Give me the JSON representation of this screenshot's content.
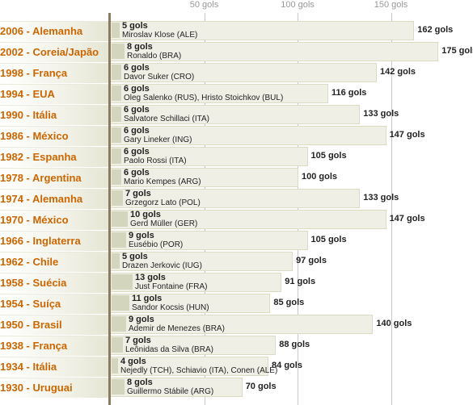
{
  "chart_data": {
    "type": "bar",
    "orientation": "horizontal",
    "axis_ticks": [
      {
        "value": 50,
        "label": "50 gols"
      },
      {
        "value": 100,
        "label": "100 gols"
      },
      {
        "value": 150,
        "label": "150 gols"
      }
    ],
    "grid": true,
    "colors": {
      "label": "#cc6600",
      "bar": "#efefe6",
      "bar_border": "#dcdcc4",
      "scorer_bar": "#d3d6bc",
      "axis": "#8b7b60"
    },
    "rows": [
      {
        "label": "2006 - Alemanha",
        "total": 162,
        "total_label": "162 gols",
        "scorer_goals": 5,
        "scorer_goals_label": "5 gols",
        "scorer": "Miroslav Klose (ALE)"
      },
      {
        "label": "2002 - Coreia/Japão",
        "total": 175,
        "total_label": "175 gols",
        "scorer_goals": 8,
        "scorer_goals_label": "8 gols",
        "scorer": "Ronaldo (BRA)"
      },
      {
        "label": "1998 - França",
        "total": 142,
        "total_label": "142 gols",
        "scorer_goals": 6,
        "scorer_goals_label": "6 gols",
        "scorer": "Davor Suker (CRO)"
      },
      {
        "label": "1994 - EUA",
        "total": 116,
        "total_label": "116 gols",
        "scorer_goals": 6,
        "scorer_goals_label": "6 gols",
        "scorer": "Oleg Salenko (RUS), Hristo Stoichkov (BUL)"
      },
      {
        "label": "1990 - Itália",
        "total": 133,
        "total_label": "133 gols",
        "scorer_goals": 6,
        "scorer_goals_label": "6 gols",
        "scorer": "Salvatore Schillaci (ITA)"
      },
      {
        "label": "1986 - México",
        "total": 147,
        "total_label": "147 gols",
        "scorer_goals": 6,
        "scorer_goals_label": "6 gols",
        "scorer": "Gary Lineker (ING)"
      },
      {
        "label": "1982 - Espanha",
        "total": 105,
        "total_label": "105 gols",
        "scorer_goals": 6,
        "scorer_goals_label": "6 gols",
        "scorer": "Paolo Rossi (ITA)"
      },
      {
        "label": "1978 - Argentina",
        "total": 100,
        "total_label": "100 gols",
        "scorer_goals": 6,
        "scorer_goals_label": "6 gols",
        "scorer": "Mario Kempes (ARG)"
      },
      {
        "label": "1974 - Alemanha",
        "total": 133,
        "total_label": "133 gols",
        "scorer_goals": 7,
        "scorer_goals_label": "7 gols",
        "scorer": "Grzegorz Lato (POL)"
      },
      {
        "label": "1970 - México",
        "total": 147,
        "total_label": "147 gols",
        "scorer_goals": 10,
        "scorer_goals_label": "10 gols",
        "scorer": "Gerd Müller (GER)"
      },
      {
        "label": "1966 - Inglaterra",
        "total": 105,
        "total_label": "105 gols",
        "scorer_goals": 9,
        "scorer_goals_label": "9 gols",
        "scorer": "Eusébio (POR)"
      },
      {
        "label": "1962 - Chile",
        "total": 97,
        "total_label": "97 gols",
        "scorer_goals": 5,
        "scorer_goals_label": "5 gols",
        "scorer": "Drazen Jerkovic (IUG)"
      },
      {
        "label": "1958 - Suécia",
        "total": 91,
        "total_label": "91 gols",
        "scorer_goals": 13,
        "scorer_goals_label": "13 gols",
        "scorer": "Just Fontaine (FRA)"
      },
      {
        "label": "1954 - Suíça",
        "total": 85,
        "total_label": "85 gols",
        "scorer_goals": 11,
        "scorer_goals_label": "11 gols",
        "scorer": "Sandor Kocsis (HUN)"
      },
      {
        "label": "1950 - Brasil",
        "total": 140,
        "total_label": "140 gols",
        "scorer_goals": 9,
        "scorer_goals_label": "9 gols",
        "scorer": "Ademir de Menezes (BRA)"
      },
      {
        "label": "1938 - França",
        "total": 88,
        "total_label": "88 gols",
        "scorer_goals": 7,
        "scorer_goals_label": "7 gols",
        "scorer": "Leônidas da Silva (BRA)"
      },
      {
        "label": "1934 - Itália",
        "total": 84,
        "total_label": "84 gols",
        "scorer_goals": 4,
        "scorer_goals_label": "4 gols",
        "scorer": "Nejedly (TCH), Schiavio (ITA), Conen (ALE)"
      },
      {
        "label": "1930 - Uruguai",
        "total": 70,
        "total_label": "70 gols",
        "scorer_goals": 8,
        "scorer_goals_label": "8 gols",
        "scorer": "Guillermo Stábile (ARG)"
      }
    ]
  }
}
